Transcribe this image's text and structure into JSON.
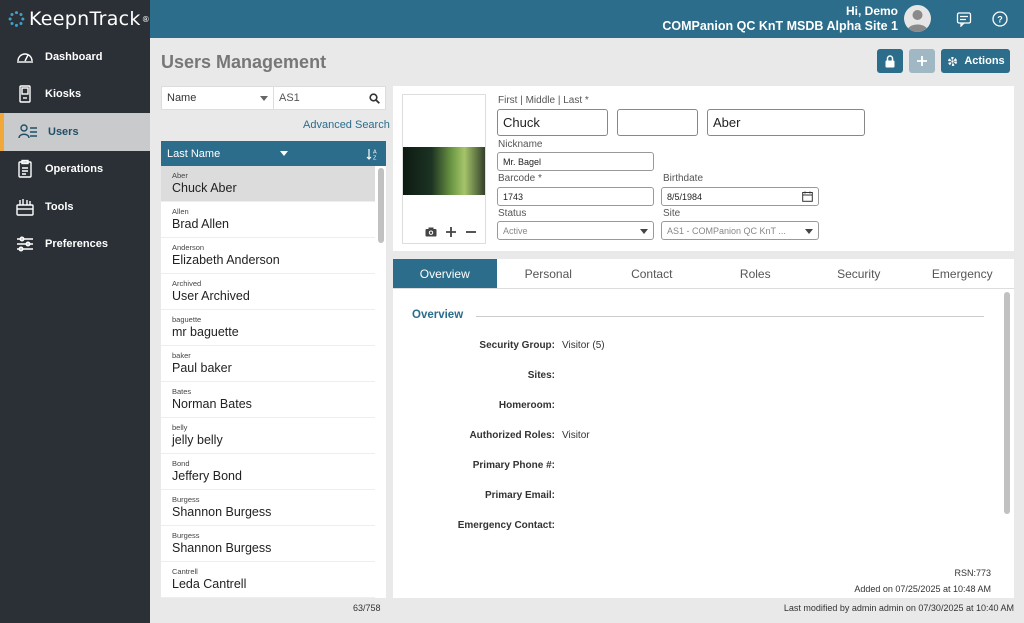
{
  "app": {
    "logo_text": "KeepnTrack",
    "logo_tm": "®"
  },
  "sidebar": {
    "items": [
      {
        "label": "Dashboard",
        "icon": "gauge-icon"
      },
      {
        "label": "Kiosks",
        "icon": "kiosk-icon"
      },
      {
        "label": "Users",
        "icon": "users-icon",
        "active": true
      },
      {
        "label": "Operations",
        "icon": "clipboard-icon"
      },
      {
        "label": "Tools",
        "icon": "toolbox-icon"
      },
      {
        "label": "Preferences",
        "icon": "sliders-icon"
      }
    ]
  },
  "header": {
    "greeting": "Hi, Demo",
    "site": "COMPanion QC KnT MSDB Alpha Site 1"
  },
  "page": {
    "title": "Users Management",
    "actions_label": "Actions"
  },
  "search": {
    "field": "Name",
    "value": "AS1",
    "advanced": "Advanced Search"
  },
  "list": {
    "column": "Last Name",
    "items": [
      {
        "key": "Aber",
        "name": "Chuck Aber"
      },
      {
        "key": "Allen",
        "name": "Brad Allen"
      },
      {
        "key": "Anderson",
        "name": "Elizabeth Anderson"
      },
      {
        "key": "Archived",
        "name": "User Archived"
      },
      {
        "key": "baguette",
        "name": "mr baguette"
      },
      {
        "key": "baker",
        "name": "Paul baker"
      },
      {
        "key": "Bates",
        "name": "Norman Bates"
      },
      {
        "key": "belly",
        "name": "jelly belly"
      },
      {
        "key": "Bond",
        "name": "Jeffery Bond"
      },
      {
        "key": "Burgess",
        "name": "Shannon Burgess"
      },
      {
        "key": "Burgess",
        "name": "Shannon Burgess"
      },
      {
        "key": "Cantrell",
        "name": "Leda Cantrell"
      }
    ],
    "count": "63/758"
  },
  "form": {
    "name_label": "First | Middle | Last *",
    "first": "Chuck",
    "middle": "",
    "last": "Aber",
    "nickname_label": "Nickname",
    "nickname": "Mr. Bagel",
    "barcode_label": "Barcode *",
    "barcode": "1743",
    "birthdate_label": "Birthdate",
    "birthdate": "8/5/1984",
    "status_label": "Status",
    "status": "Active",
    "site_label": "Site",
    "site": "AS1 - COMPanion QC KnT ..."
  },
  "tabs": [
    "Overview",
    "Personal",
    "Contact",
    "Roles",
    "Security",
    "Emergency"
  ],
  "overview": {
    "title": "Overview",
    "rows": [
      {
        "label": "Security Group:",
        "value": "Visitor (5)"
      },
      {
        "label": "Sites:",
        "value": ""
      },
      {
        "label": "Homeroom:",
        "value": ""
      },
      {
        "label": "Authorized Roles:",
        "value": "Visitor"
      },
      {
        "label": "Primary Phone #:",
        "value": ""
      },
      {
        "label": "Primary Email:",
        "value": ""
      },
      {
        "label": "Emergency Contact:",
        "value": ""
      }
    ],
    "rsn": "RSN:773",
    "added": "Added on 07/25/2025 at 10:48 AM"
  },
  "footer": {
    "modified": "Last modified by admin admin on 07/30/2025 at 10:40 AM"
  }
}
